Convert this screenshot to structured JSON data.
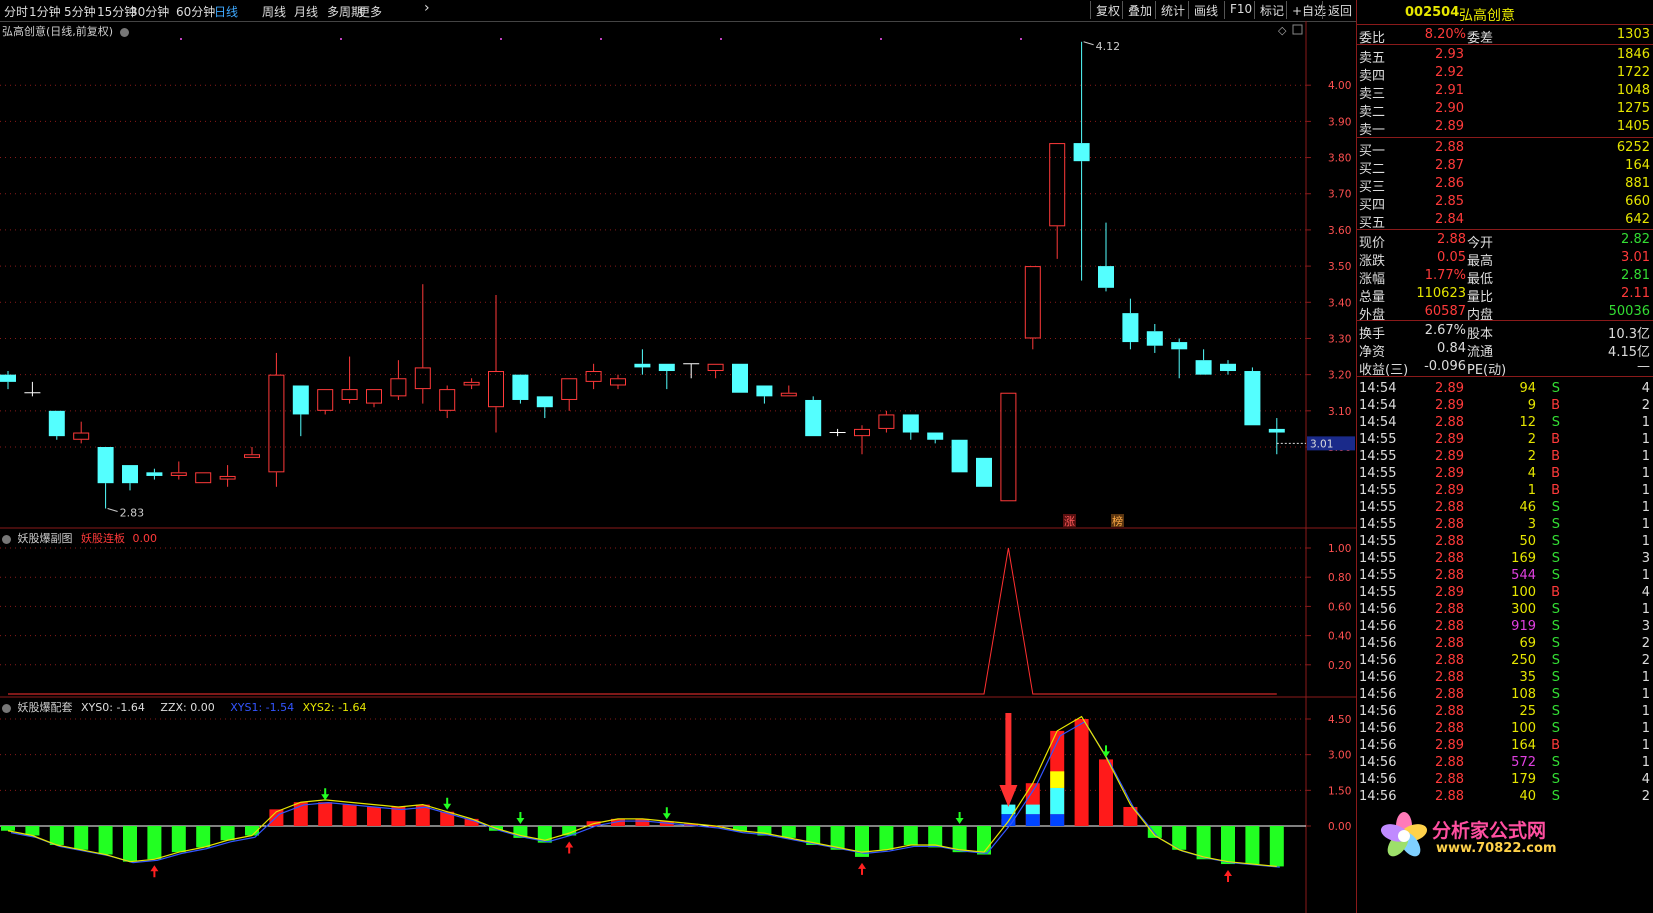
{
  "toolbar": {
    "periods": [
      "分时",
      "1分钟",
      "5分钟",
      "15分钟",
      "30分钟",
      "60分钟",
      "日线",
      "周线",
      "月线",
      "多周期",
      "更多"
    ],
    "active": "日线",
    "right_buttons": [
      "复权",
      "叠加",
      "统计",
      "画线",
      "F10",
      "标记",
      "+自选",
      "返回"
    ]
  },
  "main": {
    "title": "弘高创意(日线,前复权)",
    "high_label": "4.12",
    "low_label": "2.83",
    "current_price_tag": "3.01",
    "badge_zhang": "涨",
    "badge_bang": "榜",
    "y_ticks": [
      "4.00",
      "3.90",
      "3.80",
      "3.70",
      "3.60",
      "3.50",
      "3.40",
      "3.30",
      "3.20",
      "3.10",
      "3.00"
    ],
    "candles": [
      {
        "o": 3.2,
        "c": 3.18,
        "h": 3.21,
        "l": 3.16
      },
      {
        "o": 3.15,
        "c": 3.15,
        "h": 3.18,
        "l": 3.14
      },
      {
        "o": 3.1,
        "c": 3.03,
        "h": 3.1,
        "l": 3.02
      },
      {
        "o": 3.02,
        "c": 3.04,
        "h": 3.07,
        "l": 3.01
      },
      {
        "o": 3.0,
        "c": 2.9,
        "h": 3.0,
        "l": 2.83
      },
      {
        "o": 2.95,
        "c": 2.9,
        "h": 2.95,
        "l": 2.88
      },
      {
        "o": 2.93,
        "c": 2.92,
        "h": 2.94,
        "l": 2.91
      },
      {
        "o": 2.92,
        "c": 2.93,
        "h": 2.96,
        "l": 2.91
      },
      {
        "o": 2.9,
        "c": 2.93,
        "h": 2.93,
        "l": 2.9
      },
      {
        "o": 2.91,
        "c": 2.92,
        "h": 2.95,
        "l": 2.89
      },
      {
        "o": 2.97,
        "c": 2.98,
        "h": 3.0,
        "l": 2.97
      },
      {
        "o": 2.93,
        "c": 3.2,
        "h": 3.26,
        "l": 2.89
      },
      {
        "o": 3.17,
        "c": 3.09,
        "h": 3.17,
        "l": 3.03
      },
      {
        "o": 3.1,
        "c": 3.16,
        "h": 3.16,
        "l": 3.09
      },
      {
        "o": 3.13,
        "c": 3.16,
        "h": 3.25,
        "l": 3.12
      },
      {
        "o": 3.12,
        "c": 3.16,
        "h": 3.16,
        "l": 3.11
      },
      {
        "o": 3.14,
        "c": 3.19,
        "h": 3.24,
        "l": 3.13
      },
      {
        "o": 3.16,
        "c": 3.22,
        "h": 3.45,
        "l": 3.12
      },
      {
        "o": 3.1,
        "c": 3.16,
        "h": 3.17,
        "l": 3.08
      },
      {
        "o": 3.17,
        "c": 3.18,
        "h": 3.19,
        "l": 3.16
      },
      {
        "o": 3.11,
        "c": 3.21,
        "h": 3.42,
        "l": 3.04
      },
      {
        "o": 3.2,
        "c": 3.13,
        "h": 3.2,
        "l": 3.12
      },
      {
        "o": 3.14,
        "c": 3.11,
        "h": 3.14,
        "l": 3.08
      },
      {
        "o": 3.13,
        "c": 3.19,
        "h": 3.19,
        "l": 3.1
      },
      {
        "o": 3.18,
        "c": 3.21,
        "h": 3.23,
        "l": 3.16
      },
      {
        "o": 3.17,
        "c": 3.19,
        "h": 3.2,
        "l": 3.16
      },
      {
        "o": 3.23,
        "c": 3.22,
        "h": 3.27,
        "l": 3.2
      },
      {
        "o": 3.23,
        "c": 3.21,
        "h": 3.23,
        "l": 3.16
      },
      {
        "o": 3.23,
        "c": 3.23,
        "h": 3.23,
        "l": 3.19
      },
      {
        "o": 3.21,
        "c": 3.23,
        "h": 3.23,
        "l": 3.19
      },
      {
        "o": 3.23,
        "c": 3.15,
        "h": 3.23,
        "l": 3.15
      },
      {
        "o": 3.17,
        "c": 3.14,
        "h": 3.17,
        "l": 3.12
      },
      {
        "o": 3.14,
        "c": 3.15,
        "h": 3.17,
        "l": 3.14
      },
      {
        "o": 3.13,
        "c": 3.03,
        "h": 3.14,
        "l": 3.03
      },
      {
        "o": 3.04,
        "c": 3.04,
        "h": 3.05,
        "l": 3.03
      },
      {
        "o": 3.03,
        "c": 3.05,
        "h": 3.06,
        "l": 2.98
      },
      {
        "o": 3.05,
        "c": 3.09,
        "h": 3.1,
        "l": 3.04
      },
      {
        "o": 3.09,
        "c": 3.04,
        "h": 3.09,
        "l": 3.02
      },
      {
        "o": 3.04,
        "c": 3.02,
        "h": 3.04,
        "l": 3.01
      },
      {
        "o": 3.02,
        "c": 2.93,
        "h": 3.02,
        "l": 2.93
      },
      {
        "o": 2.97,
        "c": 2.89,
        "h": 2.97,
        "l": 2.89
      },
      {
        "o": 2.85,
        "c": 3.15,
        "h": 3.15,
        "l": 2.85
      },
      {
        "o": 3.3,
        "c": 3.5,
        "h": 3.5,
        "l": 3.27
      },
      {
        "o": 3.61,
        "c": 3.84,
        "h": 3.84,
        "l": 3.52
      },
      {
        "o": 3.84,
        "c": 3.79,
        "h": 4.12,
        "l": 3.46
      },
      {
        "o": 3.5,
        "c": 3.44,
        "h": 3.62,
        "l": 3.43
      },
      {
        "o": 3.37,
        "c": 3.29,
        "h": 3.41,
        "l": 3.27
      },
      {
        "o": 3.32,
        "c": 3.28,
        "h": 3.34,
        "l": 3.26
      },
      {
        "o": 3.29,
        "c": 3.27,
        "h": 3.3,
        "l": 3.19
      },
      {
        "o": 3.24,
        "c": 3.2,
        "h": 3.27,
        "l": 3.2
      },
      {
        "o": 3.23,
        "c": 3.21,
        "h": 3.24,
        "l": 3.2
      },
      {
        "o": 3.21,
        "c": 3.06,
        "h": 3.22,
        "l": 3.06
      },
      {
        "o": 3.05,
        "c": 3.04,
        "h": 3.08,
        "l": 2.98
      }
    ]
  },
  "sub1": {
    "title": "妖股爆副图",
    "series_label": "妖股连板",
    "series_value": "0.00",
    "y_ticks": [
      "1.00",
      "0.80",
      "0.60",
      "0.40",
      "0.20"
    ],
    "values": [
      0,
      0,
      0,
      0,
      0,
      0,
      0,
      0,
      0,
      0,
      0,
      0,
      0,
      0,
      0,
      0,
      0,
      0,
      0,
      0,
      0,
      0,
      0,
      0,
      0,
      0,
      0,
      0,
      0,
      0,
      0,
      0,
      0,
      0,
      0,
      0,
      0,
      0,
      0,
      0,
      0,
      1,
      0,
      0,
      0,
      0,
      0,
      0,
      0,
      0,
      0,
      0,
      0
    ]
  },
  "sub2": {
    "title": "妖股爆配套",
    "xys0_label": "XYS0: -1.64",
    "zzx_label": "ZZX: 0.00",
    "xys1_label": "XYS1: -1.54",
    "xys2_label": "XYS2: -1.64",
    "y_ticks": [
      "4.50",
      "3.00",
      "1.50",
      "0.00"
    ],
    "bars": [
      -0.2,
      -0.4,
      -0.8,
      -1.0,
      -1.2,
      -1.5,
      -1.4,
      -1.1,
      -0.9,
      -0.6,
      -0.4,
      0.7,
      1.0,
      1.0,
      0.9,
      0.8,
      0.8,
      0.9,
      0.6,
      0.3,
      -0.2,
      -0.5,
      -0.7,
      -0.4,
      0.2,
      0.3,
      0.3,
      0.2,
      0.1,
      0.0,
      -0.2,
      -0.4,
      -0.5,
      -0.8,
      -1.0,
      -1.3,
      -1.0,
      -0.8,
      -0.9,
      -1.1,
      -1.2,
      0.3,
      1.8,
      4.0,
      4.5,
      2.8,
      0.8,
      -0.5,
      -1.0,
      -1.4,
      -1.6,
      -1.6,
      -1.7
    ],
    "line": [
      -0.2,
      -0.4,
      -0.8,
      -1.0,
      -1.2,
      -1.5,
      -1.4,
      -1.1,
      -0.9,
      -0.6,
      -0.4,
      0.6,
      1.0,
      1.1,
      1.0,
      0.9,
      0.8,
      0.9,
      0.6,
      0.3,
      -0.1,
      -0.4,
      -0.6,
      -0.3,
      0.1,
      0.3,
      0.3,
      0.2,
      0.1,
      0.0,
      -0.2,
      -0.3,
      -0.5,
      -0.7,
      -0.9,
      -1.1,
      -1.0,
      -0.8,
      -0.8,
      -1.0,
      -1.1,
      0.2,
      1.8,
      4.0,
      4.6,
      2.9,
      0.9,
      -0.4,
      -1.0,
      -1.3,
      -1.5,
      -1.6,
      -1.7
    ],
    "blocks": {
      "41": {
        "cyan": 0.9,
        "blue": 0.5
      },
      "42": {
        "cyan": 0.9,
        "blue": 0.5
      },
      "43": {
        "cyan": 1.6,
        "blue": 0.5,
        "yellow": 0.7
      }
    },
    "up_arrows": [
      6,
      23,
      35,
      50
    ],
    "down_arrows": [
      13,
      18,
      21,
      27,
      39,
      45
    ]
  },
  "panel": {
    "code": "002504",
    "name": "弘高创意",
    "weibi_label": "委比",
    "weibi": "8.20%",
    "weicha_label": "委差",
    "weicha": "1303",
    "asks": [
      {
        "label": "卖五",
        "price": "2.93",
        "vol": "1846"
      },
      {
        "label": "卖四",
        "price": "2.92",
        "vol": "1722"
      },
      {
        "label": "卖三",
        "price": "2.91",
        "vol": "1048"
      },
      {
        "label": "卖二",
        "price": "2.90",
        "vol": "1275"
      },
      {
        "label": "卖一",
        "price": "2.89",
        "vol": "1405"
      }
    ],
    "bids": [
      {
        "label": "买一",
        "price": "2.88",
        "vol": "6252"
      },
      {
        "label": "买二",
        "price": "2.87",
        "vol": "164"
      },
      {
        "label": "买三",
        "price": "2.86",
        "vol": "881"
      },
      {
        "label": "买四",
        "price": "2.85",
        "vol": "660"
      },
      {
        "label": "买五",
        "price": "2.84",
        "vol": "642"
      }
    ],
    "stats": [
      {
        "l1": "现价",
        "v1": "2.88",
        "c1": "red",
        "l2": "今开",
        "v2": "2.82",
        "c2": "grn"
      },
      {
        "l1": "涨跌",
        "v1": "0.05",
        "c1": "red",
        "l2": "最高",
        "v2": "3.01",
        "c2": "red"
      },
      {
        "l1": "涨幅",
        "v1": "1.77%",
        "c1": "red",
        "l2": "最低",
        "v2": "2.81",
        "c2": "grn"
      },
      {
        "l1": "总量",
        "v1": "110623",
        "c1": "yel",
        "l2": "量比",
        "v2": "2.11",
        "c2": "red"
      },
      {
        "l1": "外盘",
        "v1": "60587",
        "c1": "red",
        "l2": "内盘",
        "v2": "50036",
        "c2": "grn"
      }
    ],
    "stats2": [
      {
        "l1": "换手",
        "v1": "2.67%",
        "l2": "股本",
        "v2": "10.3亿"
      },
      {
        "l1": "净资",
        "v1": "0.84",
        "l2": "流通",
        "v2": "4.15亿"
      },
      {
        "l1": "收益(三)",
        "v1": "-0.096",
        "l2": "PE(动)",
        "v2": "—"
      }
    ],
    "ticks": [
      {
        "t": "14:54",
        "p": "2.89",
        "v": "94",
        "bs": "S",
        "n": "4"
      },
      {
        "t": "14:54",
        "p": "2.89",
        "v": "9",
        "bs": "B",
        "n": "2"
      },
      {
        "t": "14:54",
        "p": "2.88",
        "v": "12",
        "bs": "S",
        "n": "1"
      },
      {
        "t": "14:55",
        "p": "2.89",
        "v": "2",
        "bs": "B",
        "n": "1"
      },
      {
        "t": "14:55",
        "p": "2.89",
        "v": "2",
        "bs": "B",
        "n": "1"
      },
      {
        "t": "14:55",
        "p": "2.89",
        "v": "4",
        "bs": "B",
        "n": "1"
      },
      {
        "t": "14:55",
        "p": "2.89",
        "v": "1",
        "bs": "B",
        "n": "1"
      },
      {
        "t": "14:55",
        "p": "2.88",
        "v": "46",
        "bs": "S",
        "n": "1"
      },
      {
        "t": "14:55",
        "p": "2.88",
        "v": "3",
        "bs": "S",
        "n": "1"
      },
      {
        "t": "14:55",
        "p": "2.88",
        "v": "50",
        "bs": "S",
        "n": "1"
      },
      {
        "t": "14:55",
        "p": "2.88",
        "v": "169",
        "bs": "S",
        "n": "3"
      },
      {
        "t": "14:55",
        "p": "2.88",
        "v": "544",
        "bs": "S",
        "n": "1"
      },
      {
        "t": "14:55",
        "p": "2.89",
        "v": "100",
        "bs": "B",
        "n": "4"
      },
      {
        "t": "14:56",
        "p": "2.88",
        "v": "300",
        "bs": "S",
        "n": "1"
      },
      {
        "t": "14:56",
        "p": "2.88",
        "v": "919",
        "bs": "S",
        "n": "3"
      },
      {
        "t": "14:56",
        "p": "2.88",
        "v": "69",
        "bs": "S",
        "n": "2"
      },
      {
        "t": "14:56",
        "p": "2.88",
        "v": "250",
        "bs": "S",
        "n": "2"
      },
      {
        "t": "14:56",
        "p": "2.88",
        "v": "35",
        "bs": "S",
        "n": "1"
      },
      {
        "t": "14:56",
        "p": "2.88",
        "v": "108",
        "bs": "S",
        "n": "1"
      },
      {
        "t": "14:56",
        "p": "2.88",
        "v": "25",
        "bs": "S",
        "n": "1"
      },
      {
        "t": "14:56",
        "p": "2.88",
        "v": "100",
        "bs": "S",
        "n": "1"
      },
      {
        "t": "14:56",
        "p": "2.89",
        "v": "164",
        "bs": "B",
        "n": "1"
      },
      {
        "t": "14:56",
        "p": "2.88",
        "v": "572",
        "bs": "S",
        "n": "1"
      },
      {
        "t": "14:56",
        "p": "2.88",
        "v": "179",
        "bs": "S",
        "n": "4"
      },
      {
        "t": "14:56",
        "p": "2.88",
        "v": "40",
        "bs": "S",
        "n": "2"
      }
    ]
  },
  "watermark": {
    "name": "分析家公式网",
    "url": "www.70822.com"
  },
  "colors": {
    "up": "#ff3a3a",
    "down": "#54ffff",
    "grid": "#8a1a1a",
    "bg": "#000000",
    "green_bar": "#22ff22",
    "blue": "#0044ff",
    "yellow": "#ffff00"
  }
}
